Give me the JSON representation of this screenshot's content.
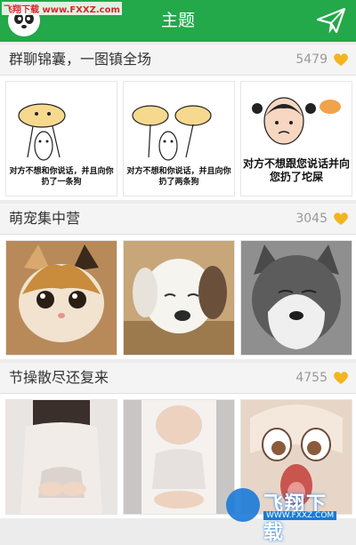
{
  "app": {
    "watermark_top": "飞翔下载 www.FXXZ.com",
    "title": "主题",
    "avatar_icon": "panda-face-icon",
    "send_icon": "paper-plane-icon",
    "brand_green": "#23a84a",
    "heart_color": "#f2b51e"
  },
  "sections": [
    {
      "title": "群聊锦囊，一图镇全场",
      "count": "5479",
      "thumbs": [
        {
          "caption": "对方不想和你说话，并且向你扔了一条狗"
        },
        {
          "caption": "对方不想和你说话，并且向你扔了两条狗"
        },
        {
          "caption": "对方不想跟您说话并向您扔了坨屎"
        }
      ]
    },
    {
      "title": "萌宠集中营",
      "count": "3045",
      "thumbs": [
        {
          "image": "cat-photo"
        },
        {
          "image": "puppy-photo"
        },
        {
          "image": "husky-photo"
        }
      ]
    },
    {
      "title": "节操散尽还复来",
      "count": "4755",
      "thumbs": [
        {
          "image": "woman-photo-1"
        },
        {
          "image": "woman-photo-2"
        },
        {
          "image": "anime-face-photo"
        }
      ]
    }
  ],
  "watermark_bottom": {
    "text": "飞翔下载",
    "url": "WWW.FXXZ.COM"
  }
}
